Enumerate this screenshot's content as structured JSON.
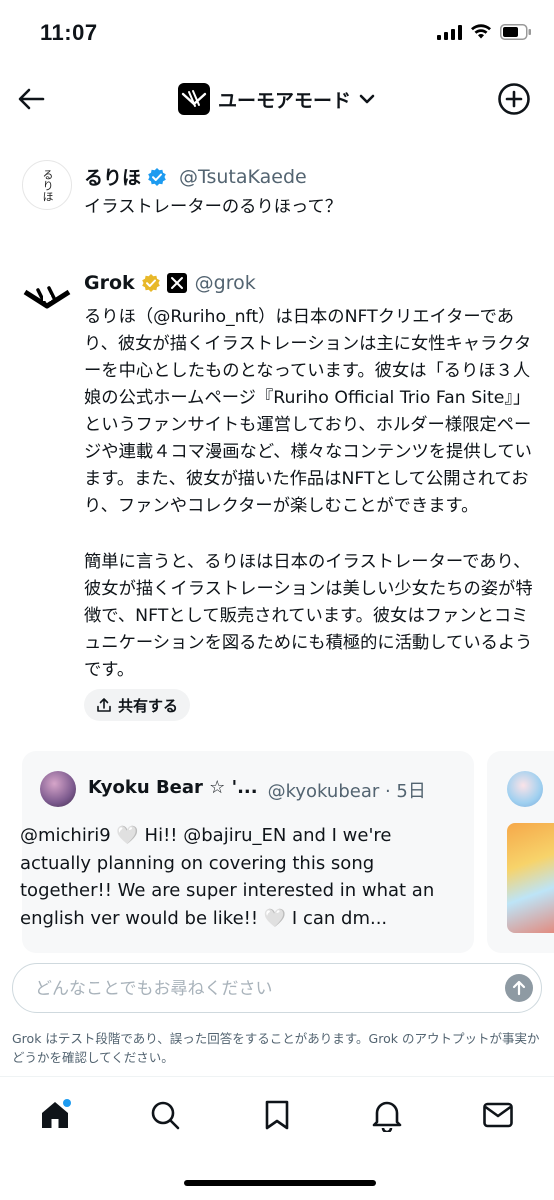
{
  "status_bar": {
    "time": "11:07"
  },
  "header": {
    "mode_label": "ユーモアモード"
  },
  "user_message": {
    "name": "るりほ",
    "handle": "@TsutaKaede",
    "text": "イラストレーターのるりほって？",
    "avatar_text": "るりほ"
  },
  "grok_message": {
    "name": "Grok",
    "handle": "@grok",
    "paragraphs": [
      "るりほ（@Ruriho_nft）は日本のNFTクリエイターであり、彼女が描くイラストレーションは主に女性キャラクターを中心としたものとなっています。彼女は「るりほ３人娘の公式ホームページ『Ruriho Official Trio Fan Site』」というファンサイトも運営しており、ホルダー様限定ページや連載４コマ漫画など、様々なコンテンツを提供しています。また、彼女が描いた作品はNFTとして公開されており、ファンやコレクターが楽しむことができます。",
      "簡単に言うと、るりほは日本のイラストレーターであり、彼女が描くイラストレーションは美しい少女たちの姿が特徴で、NFTとして販売されています。彼女はファンとコミュニケーションを図るためにも積極的に活動しているようです。"
    ],
    "share_label": "共有する"
  },
  "post_card": {
    "name": "Kyoku Bear ☆ '...",
    "handle": "@kyokubear · 5日",
    "text": "@michiri9 🤍 Hi!! @bajiru_EN and I we're actually planning on covering this song together!! We are super interested in what an english ver would be like!! 🤍 I can dm..."
  },
  "input": {
    "placeholder": "どんなことでもお尋ねください"
  },
  "disclaimer": "Grok はテスト段階であり、誤った回答をすることがあります。Grok のアウトプットが事実かどうかを確認してください。",
  "colors": {
    "verified_blue": "#1d9bf0",
    "verified_gold": "#e8b829",
    "accent": "#1d9bf0",
    "secondary_text": "#536471"
  },
  "icons": [
    "back-arrow-icon",
    "chevron-down-icon",
    "plus-circle-icon",
    "verified-badge-icon",
    "share-icon",
    "send-arrow-icon",
    "home-icon",
    "search-icon",
    "bookmark-icon",
    "bell-icon",
    "mail-icon"
  ]
}
